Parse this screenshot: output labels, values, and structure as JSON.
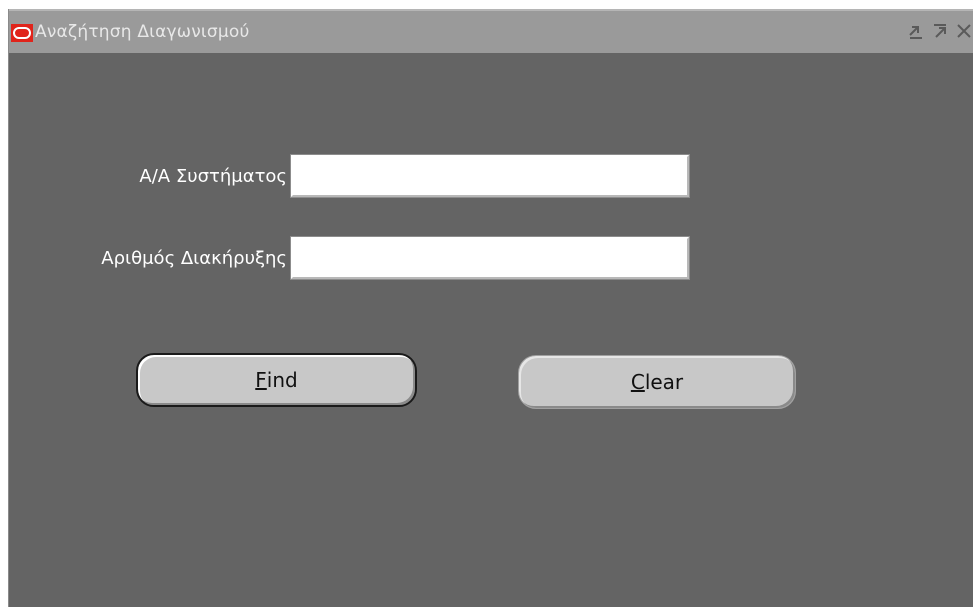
{
  "window": {
    "title": "Αναζήτηση Διαγωνισμού",
    "controls": [
      "minimize-icon",
      "maximize-icon",
      "close-icon"
    ]
  },
  "form": {
    "fields": [
      {
        "label": "Α/Α Συστήματος",
        "value": ""
      },
      {
        "label": "Αριθμός Διακήρυξης",
        "value": ""
      }
    ]
  },
  "buttons": {
    "find": {
      "mnemonic": "F",
      "rest": "ind"
    },
    "clear": {
      "mnemonic": "C",
      "rest": "lear"
    }
  },
  "colors": {
    "canvas": "#646464",
    "titlebar": "#9a9a9a",
    "oracle_red": "#e0241b",
    "button_face": "#c8c8c8"
  }
}
